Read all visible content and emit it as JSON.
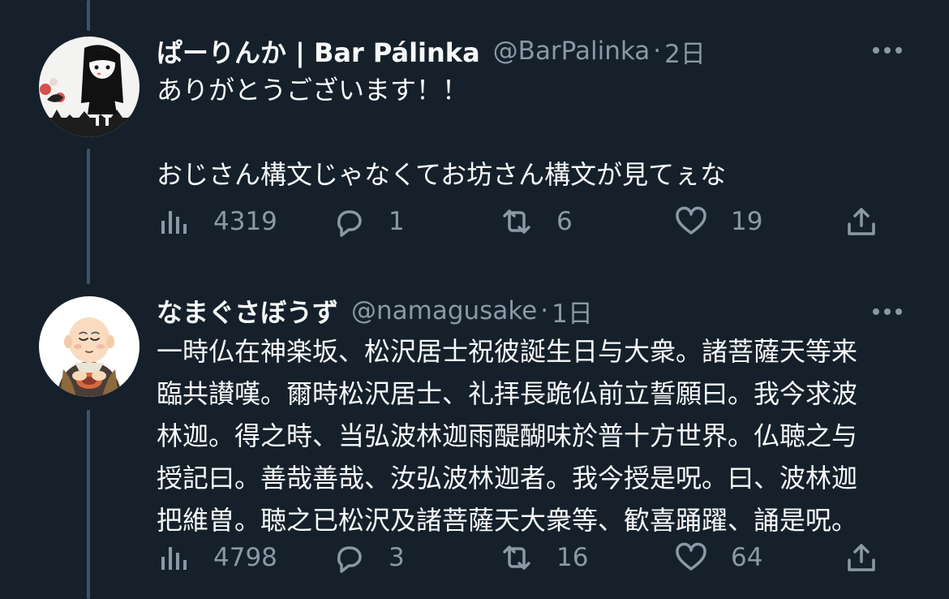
{
  "tweets": [
    {
      "display_name": "ぱーりんか | Bar Pálinka",
      "handle": "@BarPalinka",
      "separator": "·",
      "time": "2日",
      "text_lines": [
        "ありがとうございます！！",
        "",
        "おじさん構文じゃなくてお坊さん構文が見てぇな"
      ],
      "views": "4319",
      "replies": "1",
      "retweets": "6",
      "likes": "19"
    },
    {
      "display_name": "なまぐさぼうず",
      "handle": "@namagusake",
      "separator": "·",
      "time": "1日",
      "text_lines": [
        "一時仏在神楽坂、松沢居士祝彼誕生日与大衆。諸菩薩天等来",
        "臨共讃嘆。爾時松沢居士、礼拝長跪仏前立誓願曰。我今求波",
        "林迦。得之時、当弘波林迦雨醍醐味於普十方世界。仏聴之与",
        "授記曰。善哉善哉、汝弘波林迦者。我今授是呪。曰、波林迦",
        "把維曽。聴之已松沢及諸菩薩天大衆等、歓喜踊躍、誦是呪。"
      ],
      "views": "4798",
      "replies": "3",
      "retweets": "16",
      "likes": "64"
    }
  ],
  "colors": {
    "background": "#15202b",
    "primary_text": "#f7f9f9",
    "secondary_text": "#8b98a5",
    "thread_line": "#3d5466"
  },
  "icons": {
    "views": "bar-chart-icon",
    "reply": "speech-bubble-icon",
    "retweet": "retweet-arrows-icon",
    "like": "heart-icon",
    "share": "upload-icon",
    "more": "ellipsis-icon"
  }
}
